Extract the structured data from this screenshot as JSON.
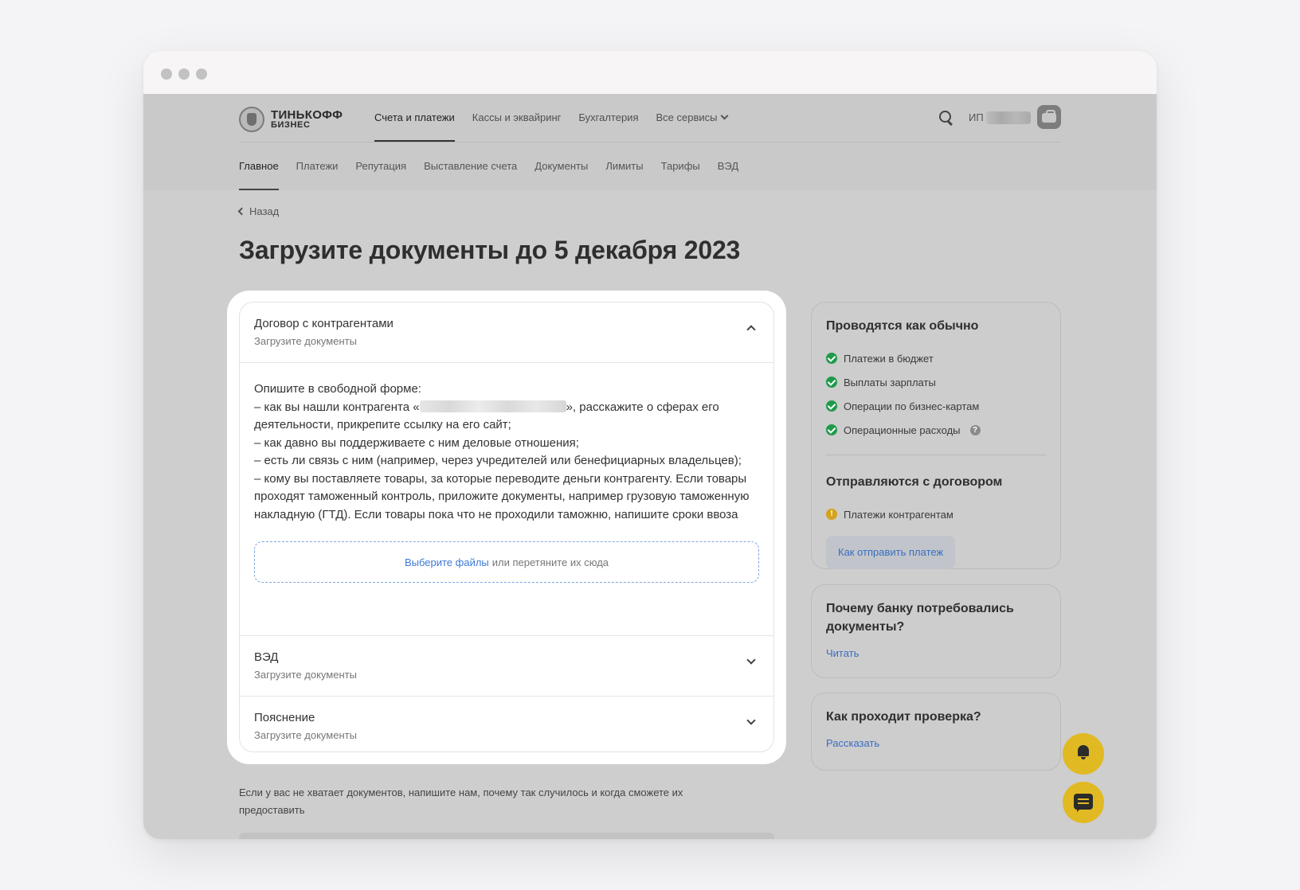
{
  "brand": {
    "title": "ТИНЬКОФФ",
    "subtitle": "БИЗНЕС"
  },
  "top_nav": [
    {
      "label": "Счета и платежи",
      "active": true
    },
    {
      "label": "Кассы и эквайринг",
      "active": false
    },
    {
      "label": "Бухгалтерия",
      "active": false
    },
    {
      "label": "Все сервисы",
      "active": false
    }
  ],
  "user": {
    "prefix": "ИП"
  },
  "sub_nav": [
    {
      "label": "Главное",
      "active": true
    },
    {
      "label": "Платежи",
      "active": false
    },
    {
      "label": "Репутация",
      "active": false
    },
    {
      "label": "Выставление счета",
      "active": false
    },
    {
      "label": "Документы",
      "active": false
    },
    {
      "label": "Лимиты",
      "active": false
    },
    {
      "label": "Тарифы",
      "active": false
    },
    {
      "label": "ВЭД",
      "active": false
    }
  ],
  "back_label": "Назад",
  "page_title": "Загрузите документы до 5 декабря 2023",
  "accordion": [
    {
      "title": "Договор с контрагентами",
      "subtitle": "Загрузите документы",
      "expanded": true,
      "body": {
        "line1": "Опишите в свободной форме:",
        "line2_pre": "– как вы нашли контрагента «",
        "line2_post": "», расскажите о сферах его деятельности, прикрепите ссылку на его сайт;",
        "line3": "– как давно вы поддерживаете с ним деловые отношения;",
        "line4": "– есть ли связь с ним (например, через учредителей или бенефициарных владельцев);",
        "line5": "– кому вы поставляете товары, за которые переводите деньги контрагенту. Если товары проходят таможенный контроль, приложите документы, например грузовую таможенную накладную (ГТД). Если товары пока что не проходили таможню, напишите сроки ввоза"
      },
      "dropzone": {
        "link": "Выберите файлы",
        "text": "или перетяните их сюда"
      }
    },
    {
      "title": "ВЭД",
      "subtitle": "Загрузите документы",
      "expanded": false
    },
    {
      "title": "Пояснение",
      "subtitle": "Загрузите документы",
      "expanded": false
    }
  ],
  "note": "Если у вас не хватает документов, напишите нам, почему так случилось и когда сможете их предоставить",
  "sidebar": {
    "card1": {
      "title": "Проводятся как обычно",
      "items": [
        {
          "label": "Платежи в бюджет",
          "status": "ok"
        },
        {
          "label": "Выплаты зарплаты",
          "status": "ok"
        },
        {
          "label": "Операции по бизнес-картам",
          "status": "ok"
        },
        {
          "label": "Операционные расходы",
          "status": "ok",
          "help": "?"
        }
      ],
      "title2": "Отправляются с договором",
      "items2": [
        {
          "label": "Платежи контрагентам",
          "status": "warning",
          "icon": "!"
        }
      ],
      "button": "Как отправить платеж"
    },
    "card2": {
      "title": "Почему банку потребовались документы?",
      "link": "Читать"
    },
    "card3": {
      "title": "Как проходит проверка?",
      "link": "Рассказать"
    }
  },
  "colors": {
    "accent_yellow": "#e1b922",
    "link_blue": "#3b79d8",
    "ok_green": "#1f9a4a",
    "warn_yellow": "#d6a21c"
  }
}
